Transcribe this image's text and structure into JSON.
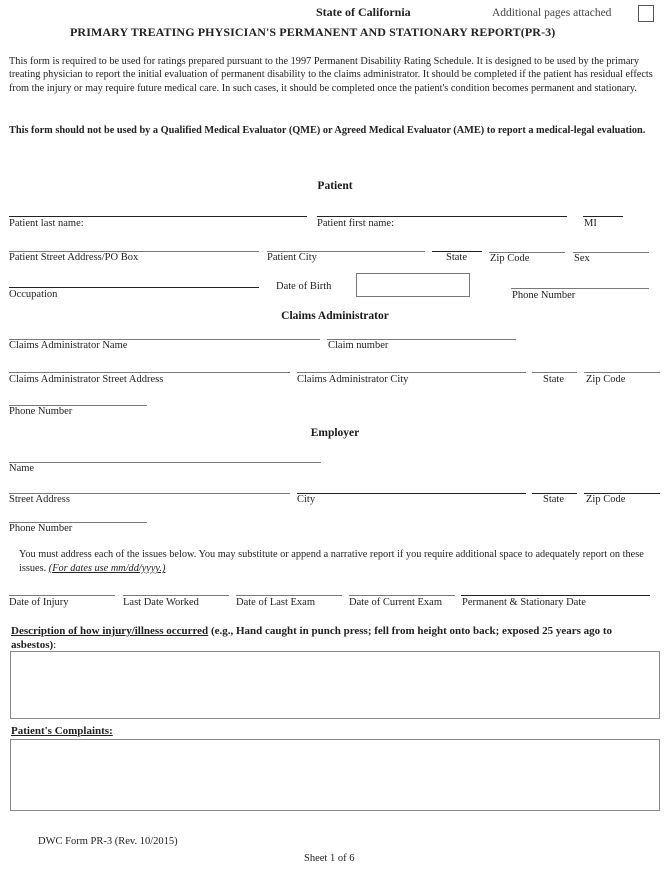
{
  "header": {
    "state": "State of California",
    "additional_pages_label": "Additional pages attached",
    "additional_pages_checked": false,
    "title": "PRIMARY TREATING PHYSICIAN'S PERMANENT AND STATIONARY REPORT(PR-3)"
  },
  "intro": {
    "paragraph": "This form is required to be used for ratings prepared pursuant to the 1997 Permanent Disability Rating Schedule.  It is designed to be used by the primary treating physician to report the initial evaluation of permanent disability to the claims administrator.  It should be completed if the patient has residual effects from the injury or may require future medical care.  In such cases, it should be completed once the patient's condition becomes permanent and stationary.",
    "warning": "This form should not be used by a Qualified Medical Evaluator (QME) or Agreed Medical Evaluator (AME) to report a medical-legal evaluation."
  },
  "patient": {
    "heading": "Patient",
    "last_name": "Patient last name:",
    "first_name": "Patient first name:",
    "mi": "MI",
    "street": "Patient Street Address/PO Box",
    "city": "Patient City",
    "state": "State",
    "zip": "Zip Code",
    "sex": "Sex",
    "occupation": "Occupation",
    "dob": "Date of Birth",
    "phone": "Phone Number"
  },
  "claims": {
    "heading": "Claims Administrator",
    "name": "Claims Administrator Name",
    "claim_number": "Claim number",
    "street": "Claims Administrator Street Address",
    "city": "Claims Administrator City",
    "state": "State",
    "zip": "Zip Code",
    "phone": "Phone Number"
  },
  "employer": {
    "heading": "Employer",
    "name": "Name",
    "street": "Street Address",
    "city": "City",
    "state": "State",
    "zip": "Zip Code",
    "phone": "Phone Number"
  },
  "instructions": {
    "text": "You must address each of the issues below. You may substitute or append a narrative report if you require additional space to adequately report on these issues.",
    "date_hint": "(For dates use mm/dd/yyyy.)"
  },
  "dates": {
    "injury": "Date of Injury",
    "last_worked": "Last Date Worked",
    "last_exam": "Date of Last Exam",
    "current_exam": "Date of Current Exam",
    "ps_date": "Permanent & Stationary Date"
  },
  "description": {
    "label": "Description of how injury/illness occurred",
    "example": " (e.g., Hand caught in punch press; fell from height onto back; exposed 25 years ago to asbestos)",
    "suffix": ":"
  },
  "complaints": {
    "label": "Patient's Complaints:"
  },
  "footer": {
    "form_id": "DWC Form PR-3 (Rev. 10/2015)",
    "sheet": "Sheet 1 of 6"
  }
}
